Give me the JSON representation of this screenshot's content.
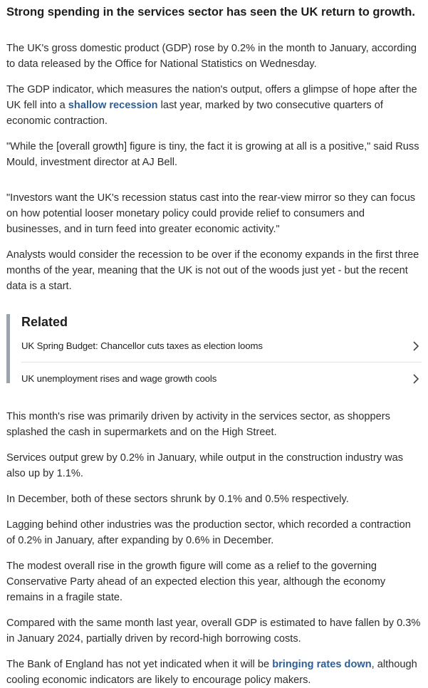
{
  "article": {
    "headline": "Strong spending in the services sector has seen the UK return to growth.",
    "paragraphs_top": [
      {
        "text": "The UK's gross domestic product (GDP) rose by 0.2% in the month to January, according to data released by the Office for National Statistics on Wednesday."
      },
      {
        "before": "The GDP indicator, which measures the nation's output, offers a glimpse of hope after the UK fell into a ",
        "link": "shallow recession",
        "after": " last year, marked by two consecutive quarters of economic contraction."
      },
      {
        "text": "\"While the [overall growth] figure is tiny, the fact it is growing at all is a positive,\" said Russ Mould, investment director at AJ Bell."
      },
      {
        "text": "\"Investors want the UK's recession status cast into the rear-view mirror so they can focus on how potential looser monetary policy could provide relief to consumers and businesses, and in turn feed into greater economic activity.\""
      },
      {
        "text": "Analysts would consider the recession to be over if the economy expands in the first three months of the year, meaning that the UK is not out of the woods just yet - but the recent data is a start."
      }
    ],
    "related": {
      "title": "Related",
      "items": [
        {
          "label": "UK Spring Budget: Chancellor cuts taxes as election looms",
          "icon": "chevron-right-icon"
        },
        {
          "label": "UK unemployment rises and wage growth cools",
          "icon": "chevron-right-icon"
        }
      ]
    },
    "paragraphs_bottom": [
      {
        "text": "This month's rise was primarily driven by activity in the services sector, as shoppers splashed the cash in supermarkets and on the High Street."
      },
      {
        "text": "Services output grew by 0.2% in January, while output in the construction industry was also up by 1.1%."
      },
      {
        "text": "In December, both of these sectors shrunk by 0.1% and 0.5% respectively."
      },
      {
        "text": "Lagging behind other industries was the production sector, which recorded a contraction of 0.2% in January, after expanding by 0.6% in December."
      },
      {
        "text": "The modest overall rise in the growth figure will come as a relief to the governing Conservative Party ahead of an expected election this year, although the economy remains in a fragile state."
      },
      {
        "text": "Compared with the same month last year, overall GDP is estimated to have fallen by 0.3% in January 2024, partially driven by record-high borrowing costs."
      },
      {
        "before": "The Bank of England has not yet indicated when it will be ",
        "link": "bringing rates down",
        "after": ", although cooling economic indicators are likely to encourage policy makers."
      }
    ]
  },
  "colors": {
    "link": "#2f5f93",
    "related_bar": "#9aa4b0",
    "text": "#2c2c2c"
  }
}
